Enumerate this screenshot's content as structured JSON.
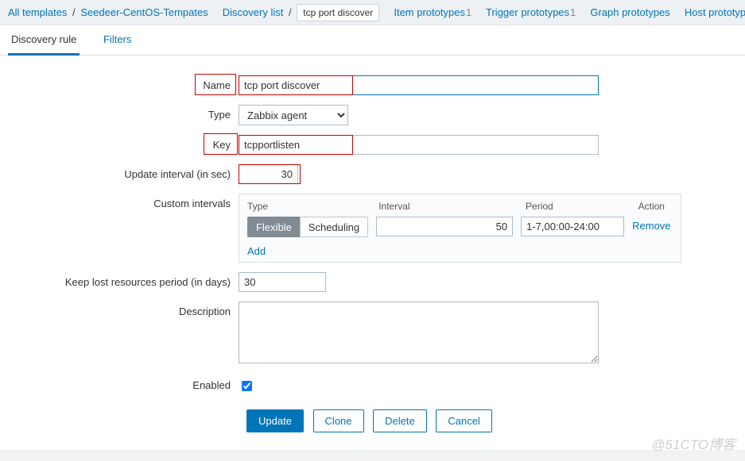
{
  "breadcrumb": {
    "all_templates": "All templates",
    "template_name": "Seedeer-CentOS-Tempates",
    "discovery_list": "Discovery list",
    "current": "tcp port discover",
    "item_prototypes": "Item prototypes",
    "item_prototypes_n": "1",
    "trigger_prototypes": "Trigger prototypes",
    "trigger_prototypes_n": "1",
    "graph_prototypes": "Graph prototypes",
    "host_prototypes": "Host prototypes"
  },
  "tabs": {
    "rule": "Discovery rule",
    "filters": "Filters"
  },
  "labels": {
    "name": "Name",
    "type": "Type",
    "key": "Key",
    "update_interval": "Update interval (in sec)",
    "custom_intervals": "Custom intervals",
    "keep_lost": "Keep lost resources period (in days)",
    "description": "Description",
    "enabled": "Enabled"
  },
  "values": {
    "name": "tcp port discover",
    "type": "Zabbix agent",
    "key": "tcpportlisten",
    "update_interval": "30",
    "keep_lost": "30",
    "description": "",
    "enabled": true
  },
  "custom": {
    "head_type": "Type",
    "head_interval": "Interval",
    "head_period": "Period",
    "head_action": "Action",
    "flexible": "Flexible",
    "scheduling": "Scheduling",
    "interval": "50",
    "period": "1-7,00:00-24:00",
    "remove": "Remove",
    "add": "Add"
  },
  "buttons": {
    "update": "Update",
    "clone": "Clone",
    "delete": "Delete",
    "cancel": "Cancel"
  },
  "watermark": "@51CTO博客"
}
